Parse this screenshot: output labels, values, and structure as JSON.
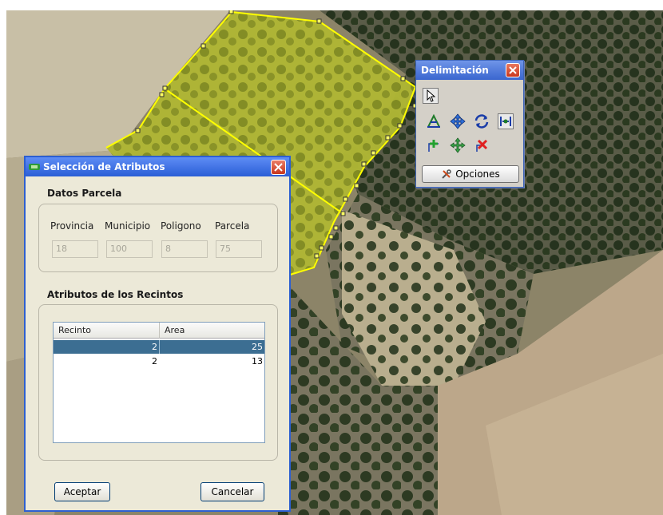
{
  "toolbar": {
    "title": "Delimitación",
    "options_label": "Opciones",
    "tools": [
      "pointer-icon",
      "split-line-icon",
      "move-vertex-icon",
      "rotate-icon",
      "snap-icon",
      "add-vertex-icon",
      "move-node-icon",
      "delete-vertex-icon"
    ]
  },
  "dialog": {
    "title": "Selección de Atributos",
    "parcel_section": "Datos Parcela",
    "fields": [
      {
        "label": "Provincia",
        "value": "18"
      },
      {
        "label": "Municipio",
        "value": "100"
      },
      {
        "label": "Poligono",
        "value": "8"
      },
      {
        "label": "Parcela",
        "value": "75"
      }
    ],
    "recintos_section": "Atributos de los Recintos",
    "columns": [
      "Recinto",
      "Area"
    ],
    "rows": [
      {
        "recinto": "2",
        "area": "25",
        "selected": true
      },
      {
        "recinto": "2",
        "area": "13",
        "selected": false
      }
    ],
    "accept_label": "Aceptar",
    "cancel_label": "Cancelar"
  },
  "colors": {
    "titlebar": "#2a5ed6",
    "dialog_bg": "#ece9d8",
    "selection": "#3c6e92",
    "parcel_fill": "#e6e62e",
    "parcel_edge": "#ffff00"
  }
}
